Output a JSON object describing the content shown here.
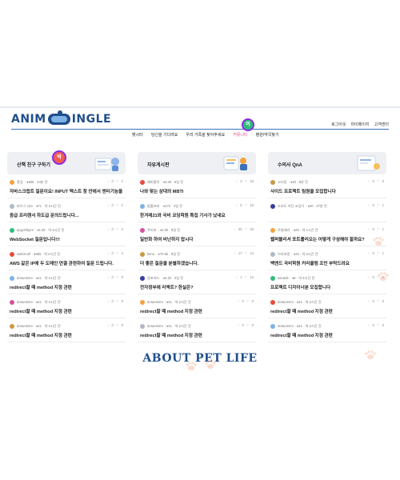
{
  "header": {
    "logo_left": "ANIM",
    "logo_right": "INGLE",
    "links": [
      "로그아웃",
      "마이페이지",
      "고객센터"
    ]
  },
  "nav": {
    "items": [
      "펫시터",
      "당신을 기다려요",
      "우리 가족을 찾아주세요",
      "커뮤니티",
      "병원/약국찾기"
    ],
    "active_index": 3,
    "badge": "이"
  },
  "columns": [
    {
      "title": "산책 친구 구하기",
      "badge": "박",
      "posts": [
        {
          "user": "홍길",
          "meta": "· ♦356 · 24분 전",
          "comments": "0",
          "likes": "1",
          "title": "자바스크립트 질문이요! INPUT 텍스트 창 안에서 엔터기능을 ..."
        },
        {
          "user": "파우스 123",
          "meta": "· ♦71 · 약 2시간 전",
          "comments": "0",
          "likes": "1",
          "title": "중급 프리랜서 하도급 문의드립니다..."
        },
        {
          "user": "qegcrbbynr",
          "meta": "· ♦1.5k · 약 2시간 전",
          "comments": "0",
          "likes": "2",
          "title": "WebSocket 질문입니다!!!"
        },
        {
          "user": "wafernoll",
          "meta": "· ♦665 · 약 2시간 전",
          "comments": "0",
          "likes": "4",
          "title": "AWS 같은 IP에 두 도메인 연결 관련하여 질문 드립니다."
        },
        {
          "user": "doraemimi",
          "meta": "· ♦41 · 약 2시간 전",
          "comments": "0",
          "likes": "0",
          "title": "redirect할 때 method 지정 관련"
        },
        {
          "user": "doraemimi",
          "meta": "· ♦41 · 약 2시간 전",
          "comments": "0",
          "likes": "0",
          "title": "redirect할 때 method 지정 관련"
        },
        {
          "user": "doraemimi",
          "meta": "· ♦41 · 약 2시간 전",
          "comments": "0",
          "likes": "0",
          "title": "redirect할 때 method 지정 관련"
        }
      ]
    },
    {
      "title": "자유게시판",
      "badge": "",
      "posts": [
        {
          "user": "해피홍로",
          "meta": "· ♦3.4k · 5일 전",
          "comments": "3",
          "likes": "10",
          "title": "나와 맞는 상대의 MBTI"
        },
        {
          "user": "밤톨포비",
          "meta": "· ♦172 · 4일 전",
          "comments": "5",
          "likes": "18",
          "title": "한겨레21와 국비 코딩학원 특집 기사가 났네요"
        },
        {
          "user": "쿠리포",
          "meta": "· ♦2.0k · 8일 전",
          "comments": "20",
          "likes": "34",
          "title": "일반화 하여 비난하지 맙시다"
        },
        {
          "user": "kenu",
          "meta": "· ♦70.6k · 8일 전",
          "comments": "17",
          "likes": "14",
          "title": "더 좋은 질문을 분별하겠습니다."
        },
        {
          "user": "원포지드",
          "meta": "· ♦4.2k · 3일 전",
          "comments": "1",
          "likes": "12",
          "title": "전자정부에 리액트? 한실은?"
        },
        {
          "user": "doraemimi",
          "meta": "· ♦41 · 약 2시간 전",
          "comments": "0",
          "likes": "0",
          "title": "redirect할 때 method 지정 관련"
        },
        {
          "user": "doraemimi",
          "meta": "· ♦41 · 약 2시간 전",
          "comments": "0",
          "likes": "0",
          "title": "redirect할 때 method 지정 관련"
        }
      ]
    },
    {
      "title": "수의사 QnA",
      "badge": "",
      "posts": [
        {
          "user": "고리동",
          "meta": "· ♦20 · 8분 전",
          "comments": "0",
          "likes": "0",
          "title": "사이드 프로젝트 팀원을 모집합니다"
        },
        {
          "user": "조보도 어딘 코딩이",
          "meta": "· ♦20 · 27분 전",
          "comments": "0",
          "likes": "1",
          "title": ""
        },
        {
          "user": "로칠캐리",
          "meta": "· ♦20 · 약 1시간 전",
          "comments": "0",
          "likes": "1",
          "title": "웹퍼블리셔 포트폴리오는 어떻게 구성해야 할까요?"
        },
        {
          "user": "브라보멍",
          "meta": "· ♦34 · 약 2시간 전",
          "comments": "0",
          "likes": "1",
          "title": "백엔드 국비학원 커리큘럼 조언 부탁드려요"
        },
        {
          "user": "asodult",
          "meta": "· ♦6 · 약 4시간 전",
          "comments": "0",
          "likes": "1",
          "title": "프로젝트 디자이너분 모집합니다"
        },
        {
          "user": "doraemimi",
          "meta": "· ♦41 · 약 2시간 전",
          "comments": "0",
          "likes": "0",
          "title": "redirect할 때 method 지정 관련"
        },
        {
          "user": "doraemimi",
          "meta": "· ♦41 · 약 2시간 전",
          "comments": "0",
          "likes": "0",
          "title": "redirect할 때 method 지정 관련"
        }
      ]
    }
  ],
  "about": "ABOUT PET LIFE",
  "colors": {
    "brand": "#1f4e8c",
    "active_nav": "#e8468a",
    "avatar": [
      "#f4a340",
      "#b0b8c4",
      "#2dbf7a",
      "#e94b3c",
      "#7fb2e5",
      "#d5529e",
      "#c94",
      "#333f9f"
    ]
  }
}
